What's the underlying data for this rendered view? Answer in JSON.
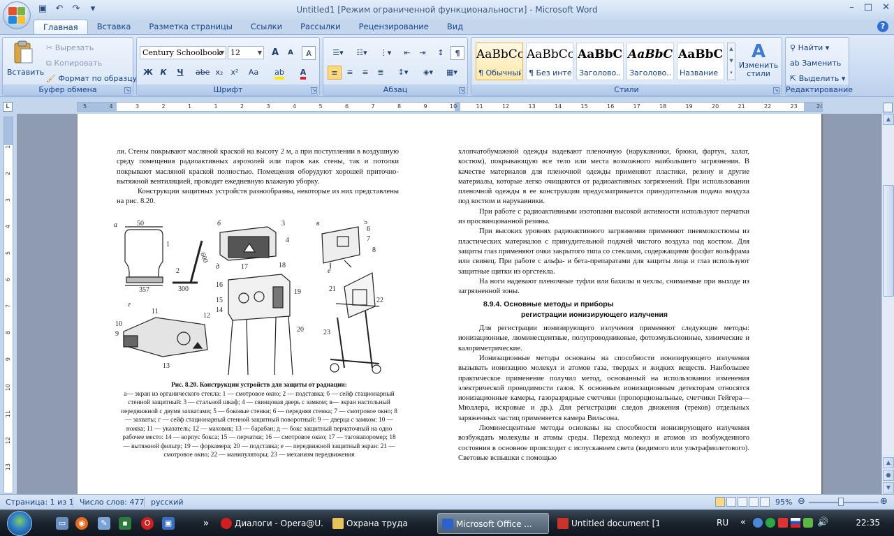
{
  "window": {
    "title": "Untitled1 [Режим ограниченной функциональности] - Microsoft Word",
    "minimize": "–",
    "maximize": "□",
    "close": "✕"
  },
  "tabs": [
    "Главная",
    "Вставка",
    "Разметка страницы",
    "Ссылки",
    "Рассылки",
    "Рецензирование",
    "Вид"
  ],
  "ribbon": {
    "clipboard": {
      "label": "Буфер обмена",
      "paste": "Вставить",
      "cut": "Вырезать",
      "copy": "Копировать",
      "format_painter": "Формат по образцу"
    },
    "font": {
      "label": "Шрифт",
      "font_name": "Century Schoolbook",
      "font_size": "12",
      "bold": "Ж",
      "italic": "К",
      "underline": "Ч",
      "strike": "abe",
      "sub": "x₂",
      "sup": "x²",
      "case": "Aa",
      "grow": "A",
      "shrink": "A"
    },
    "paragraph": {
      "label": "Абзац"
    },
    "styles": {
      "label": "Стили",
      "change_styles": "Изменить стили",
      "items": [
        {
          "sample": "AaBbCc",
          "name": "¶ Обычный"
        },
        {
          "sample": "AaBbCc",
          "name": "¶ Без инте..."
        },
        {
          "sample": "AaBbC",
          "name": "Заголово..."
        },
        {
          "sample": "AaBbC",
          "name": "Заголово..."
        },
        {
          "sample": "AaBbC",
          "name": "Название"
        }
      ]
    },
    "editing": {
      "label": "Редактирование",
      "find": "Найти",
      "replace": "Заменить",
      "select": "Выделить"
    }
  },
  "ruler": {
    "ticks": [
      "5",
      "4",
      "3",
      "2",
      "1",
      "1",
      "2",
      "3",
      "4",
      "5",
      "6",
      "7",
      "8",
      "9",
      "10",
      "11",
      "12",
      "13",
      "14",
      "15",
      "16",
      "17",
      "18",
      "19",
      "20",
      "21",
      "22",
      "23",
      "24"
    ],
    "vticks": [
      "1",
      "2",
      "3",
      "4",
      "5",
      "6",
      "7",
      "8",
      "9",
      "10",
      "11",
      "12",
      "13"
    ]
  },
  "document": {
    "left_col": [
      "ли. Стены покрывают масляной краской на высоту 2 м, а при поступлении в воздушную среду помещения радиоактивных аэрозолей или паров как стены, так и потолки покрывают масляной краской полностью. Помещения оборудуют хорошей приточно-вытяжной вентиляцией, проводят ежедневную влажную уборку.",
      "Конструкции защитных устройств разнообразны, некоторые из них представлены на рис. 8.20."
    ],
    "figure_labels": {
      "a": "а",
      "b": "б",
      "v": "в",
      "g": "г",
      "d": "д",
      "e": "е",
      "n1": "1",
      "n2": "2",
      "n3": "3",
      "n4": "4",
      "n5": "5",
      "n6": "6",
      "n7": "7",
      "n8": "8",
      "n9": "9",
      "n10": "10",
      "n11": "11",
      "n12": "12",
      "n13": "13",
      "n14": "14",
      "n15": "15",
      "n16": "16",
      "n17": "17",
      "n18": "18",
      "n19": "19",
      "n20": "20",
      "n21": "21",
      "n22": "22",
      "n23": "23",
      "dim50": "50",
      "dim357": "357",
      "dim300": "300",
      "dim600": "600"
    },
    "caption_title": "Рис. 8.20. Конструкции устройств для защиты от радиации:",
    "caption_body": "а— экран из органического стекла: 1 — смотровое окно; 2 — подставка; б — сейф стационарный стенной защитный: 3 — стальной шкаф; 4 — свинцовая дверь с замком; в— экран настольный передвижной с двумя захватами; 5 — боковые стенки; 6 — передняя стенка; 7 — смотровое окно; 8 — захваты; г — сейф стационарный стенной защитный поворотный: 9 — дверца с замком: 10 — ножка; 11 — указатель; 12 — маховик; 13 — барабан; д — бокс защитный перчаточный на одно рабочее место: 14 — корпус бокса; 15 — перчатки; 16 — смотровое окно; 17 — тагонапоромер; 18 — вытяжной фильтр; 19 — форкамера; 20 — подставка; е — передвижной защитный экран: 21 — смотровое окно; 22 — манипуляторы; 23 — механизм передвижения",
    "right_col": [
      "хлопчатобумажной одежды надевают пленочную (нарукавники, брюки, фартук, халат, костюм), покрывающую все тело или места возможного наибольшего загрязнения. В качестве материалов для пленочной одежды применяют пластики, резину и другие материалы, которые легко очищаются от радиоактивных загрязнений. При использовании пленочной одежды в ее конструкции предусматривается принудительная подача воздуха под костюм и нарукавники.",
      "При работе с радиоактивными изотопами высокой активности используют перчатки из просвинцованной резины.",
      "При высоких уровнях радиоактивного загрязнения применяют пневмокостюмы из пластических материалов с принудительной подачей чистого воздуха под костюм. Для защиты глаз применяют очки закрытого типа со стеклами, содержащими фосфат вольфрама или свинец. При работе с альфа- и бета-препаратами для защиты лица и глаз используют защитные щитки из оргстекла.",
      "На ноги надевают пленочные туфли или бахилы и чехлы, снимаемые при выходе из загрязненной зоны."
    ],
    "heading1": "8.9.4. Основные методы и приборы",
    "heading2": "регистрации ионизирующего излучения",
    "right_col2": [
      "Для регистрации ионизирующего излучения применяют следующие методы: ионизационные, люминесцентные, полупроводниковые, фотоэмульсионные, химические и калориметрические.",
      "Ионизационные методы основаны на способности ионизирующего излучения вызывать ионизацию молекул и атомов газа, твердых и жидких веществ. Наибольшее практическое применение получил метод, основанный на использовании изменения электрической проводимости газов. К основным ионизационным детекторам относятся ионизационные камеры, газоразрядные счетчики (пропорциональные, счетчики Гейгера—Мюллера, искровые и др.). Для регистрации следов движения (треков) отдельных заряженных частиц применяется камера Вильсона.",
      "Люминесцентные методы основаны на способности ионизирующего излучения возбуждать молекулы и атомы среды. Переход молекул и атомов из возбужденного состояния в основное происходит с испусканием света (видимого или ультрафиолетового). Световые вспышки с помощью"
    ]
  },
  "status": {
    "page": "Страница: 1 из 1",
    "words": "Число слов: 477",
    "lang": "русский",
    "zoom": "95%"
  },
  "taskbar": {
    "items": [
      {
        "label": "Диалоги - Opera@U...",
        "color": "#d11f1f"
      },
      {
        "label": "Охрана труда",
        "color": "#e8c25a"
      },
      {
        "label": "Microsoft Office ...",
        "color": "#2d62c9",
        "active": true
      },
      {
        "label": "Untitled document [1...",
        "color": "#c8332a"
      }
    ],
    "lang": "RU",
    "clock": "22:35",
    "chevron": "»"
  }
}
